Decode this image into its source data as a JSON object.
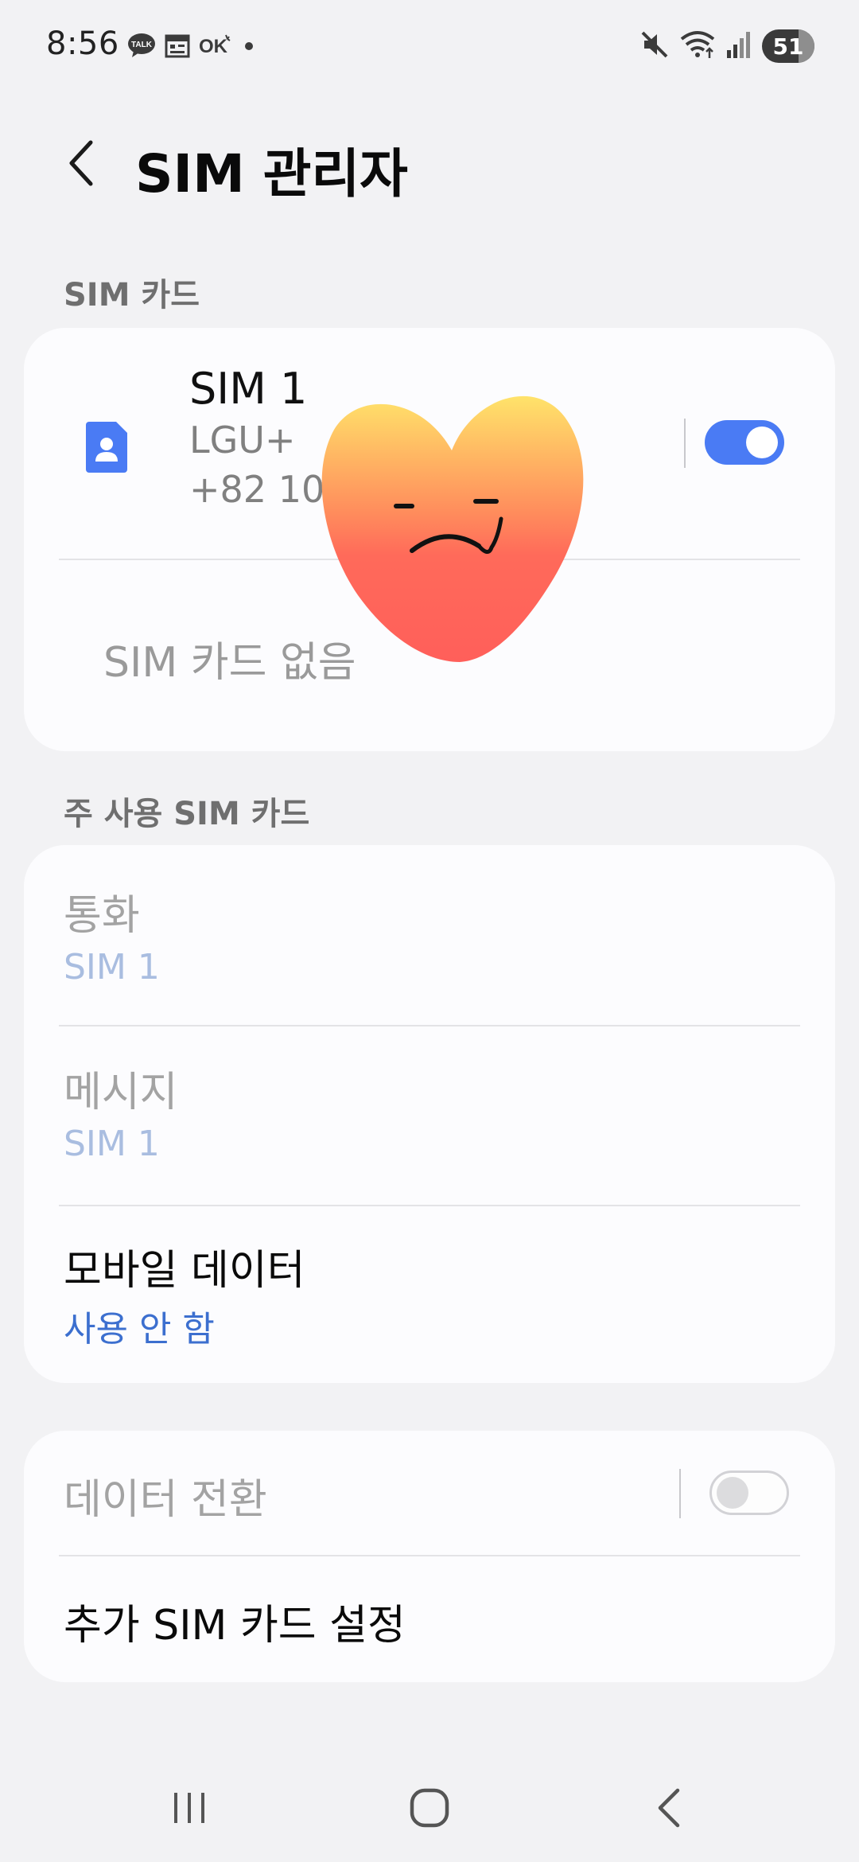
{
  "status_bar": {
    "time": "8:56",
    "left_icons": [
      "talk-icon",
      "calendar-icon",
      "ok-icon",
      "dot-icon"
    ],
    "right_icons": [
      "mute-icon",
      "wifi-icon",
      "signal-icon"
    ],
    "battery": "51"
  },
  "header": {
    "title": "SIM 관리자",
    "back_icon": "chevron-left-icon"
  },
  "sections": {
    "sim_cards_label": "SIM 카드",
    "primary_sim_label": "주 사용 SIM 카드"
  },
  "sim_card": {
    "name": "SIM 1",
    "carrier": "LGU+",
    "number": "+82 10",
    "enabled": true,
    "icon": "sim-card-icon"
  },
  "no_sim_text": "SIM 카드 없음",
  "primary": {
    "calls": {
      "title": "통화",
      "value": "SIM 1"
    },
    "messages": {
      "title": "메시지",
      "value": "SIM 1"
    },
    "mobile_data": {
      "title": "모바일 데이터",
      "value": "사용 안 함"
    }
  },
  "extra": {
    "data_switch": {
      "title": "데이터 전환",
      "enabled": false
    },
    "more_settings": {
      "title": "추가 SIM 카드 설정"
    }
  },
  "sticker": "heart-face-sticker",
  "nav_bar": [
    "recents-icon",
    "home-icon",
    "back-icon"
  ],
  "colors": {
    "accent": "#4a7bf4",
    "link_blue": "#3c6fcf",
    "background": "#f2f2f4",
    "card": "#fcfcfe"
  }
}
